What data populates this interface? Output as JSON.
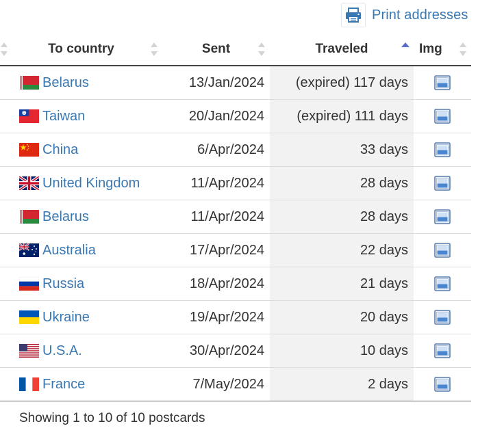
{
  "toolbar": {
    "print_label": "Print addresses",
    "print_icon": "printer-icon"
  },
  "table": {
    "columns": [
      {
        "key": "country",
        "label": "To country"
      },
      {
        "key": "sent",
        "label": "Sent"
      },
      {
        "key": "traveled",
        "label": "Traveled",
        "sorted": "ascending"
      },
      {
        "key": "img",
        "label": "Img"
      }
    ],
    "rows": [
      {
        "flag": "belarus",
        "country": "Belarus",
        "sent": "13/Jan/2024",
        "traveled": "(expired) 117 days",
        "img_icon": "image-icon"
      },
      {
        "flag": "taiwan",
        "country": "Taiwan",
        "sent": "20/Jan/2024",
        "traveled": "(expired) 111 days",
        "img_icon": "image-icon"
      },
      {
        "flag": "china",
        "country": "China",
        "sent": "6/Apr/2024",
        "traveled": "33 days",
        "img_icon": "image-icon"
      },
      {
        "flag": "uk",
        "country": "United Kingdom",
        "sent": "11/Apr/2024",
        "traveled": "28 days",
        "img_icon": "image-icon"
      },
      {
        "flag": "belarus",
        "country": "Belarus",
        "sent": "11/Apr/2024",
        "traveled": "28 days",
        "img_icon": "image-icon"
      },
      {
        "flag": "australia",
        "country": "Australia",
        "sent": "17/Apr/2024",
        "traveled": "22 days",
        "img_icon": "image-icon"
      },
      {
        "flag": "russia",
        "country": "Russia",
        "sent": "18/Apr/2024",
        "traveled": "21 days",
        "img_icon": "image-icon"
      },
      {
        "flag": "ukraine",
        "country": "Ukraine",
        "sent": "19/Apr/2024",
        "traveled": "20 days",
        "img_icon": "image-icon"
      },
      {
        "flag": "usa",
        "country": "U.S.A.",
        "sent": "30/Apr/2024",
        "traveled": "10 days",
        "img_icon": "image-icon"
      },
      {
        "flag": "france",
        "country": "France",
        "sent": "7/May/2024",
        "traveled": "2 days",
        "img_icon": "image-icon"
      }
    ]
  },
  "footer": {
    "info": "Showing 1 to 10 of 10 postcards"
  },
  "colors": {
    "link": "#3a78b2",
    "sort_active": "#5a6fc9",
    "sort_inactive": "#d4d4d4",
    "sorted_column_bg": "#f2f2f2"
  }
}
